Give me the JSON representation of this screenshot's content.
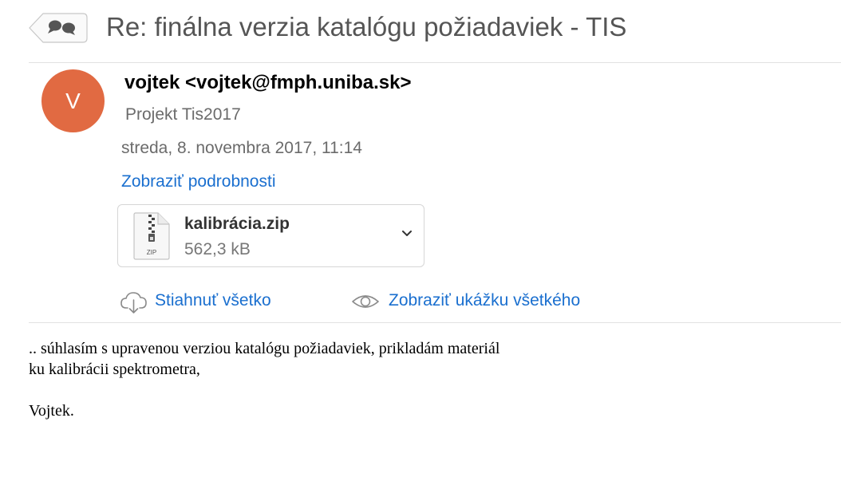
{
  "header": {
    "subject": "Re: finálna verzia katalógu požiadaviek - TIS"
  },
  "message": {
    "avatar_initial": "V",
    "avatar_color": "#e16a42",
    "sender": "vojtek <vojtek@fmph.uniba.sk>",
    "recipient": "Projekt Tis2017",
    "date": "streda, 8. novembra 2017, 11:14",
    "details_link": "Zobraziť podrobnosti"
  },
  "attachment": {
    "icon_label": "ZIP",
    "name": "kalibrácia.zip",
    "size": "562,3 kB"
  },
  "actions": {
    "download_all": "Stiahnuť všetko",
    "preview_all": "Zobraziť ukážku všetkého"
  },
  "body": {
    "line1": ".. súhlasím s upravenou verziou katalógu požiadaviek, prikladám materiál",
    "line2": "ku kalibrácii spektrometra,",
    "signature": "Vojtek."
  },
  "colors": {
    "link": "#1a6fcf",
    "avatar": "#e16a42"
  }
}
